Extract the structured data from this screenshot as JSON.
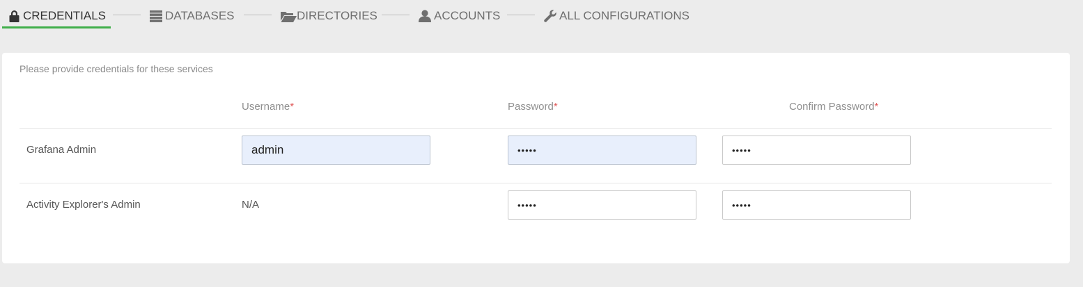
{
  "wizard": {
    "steps": [
      {
        "label": "CREDENTIALS",
        "icon": "lock-icon",
        "active": true
      },
      {
        "label": "DATABASES",
        "icon": "database-icon",
        "active": false
      },
      {
        "label": "DIRECTORIES",
        "icon": "folder-open-icon",
        "active": false
      },
      {
        "label": "ACCOUNTS",
        "icon": "user-icon",
        "active": false
      },
      {
        "label": "ALL CONFIGURATIONS",
        "icon": "wrench-icon",
        "active": false
      }
    ],
    "active_color": "#3fae49"
  },
  "credentials": {
    "intro": "Please provide credentials for these services",
    "columns": {
      "username": "Username",
      "password": "Password",
      "confirm_password": "Confirm Password",
      "required_marker": "*"
    },
    "rows": [
      {
        "service": "Grafana Admin",
        "username": "admin",
        "password": "•••••",
        "confirm_password": "•••••"
      },
      {
        "service": "Activity Explorer's Admin",
        "username": "N/A",
        "password": "•••••",
        "confirm_password": "•••••"
      }
    ]
  }
}
